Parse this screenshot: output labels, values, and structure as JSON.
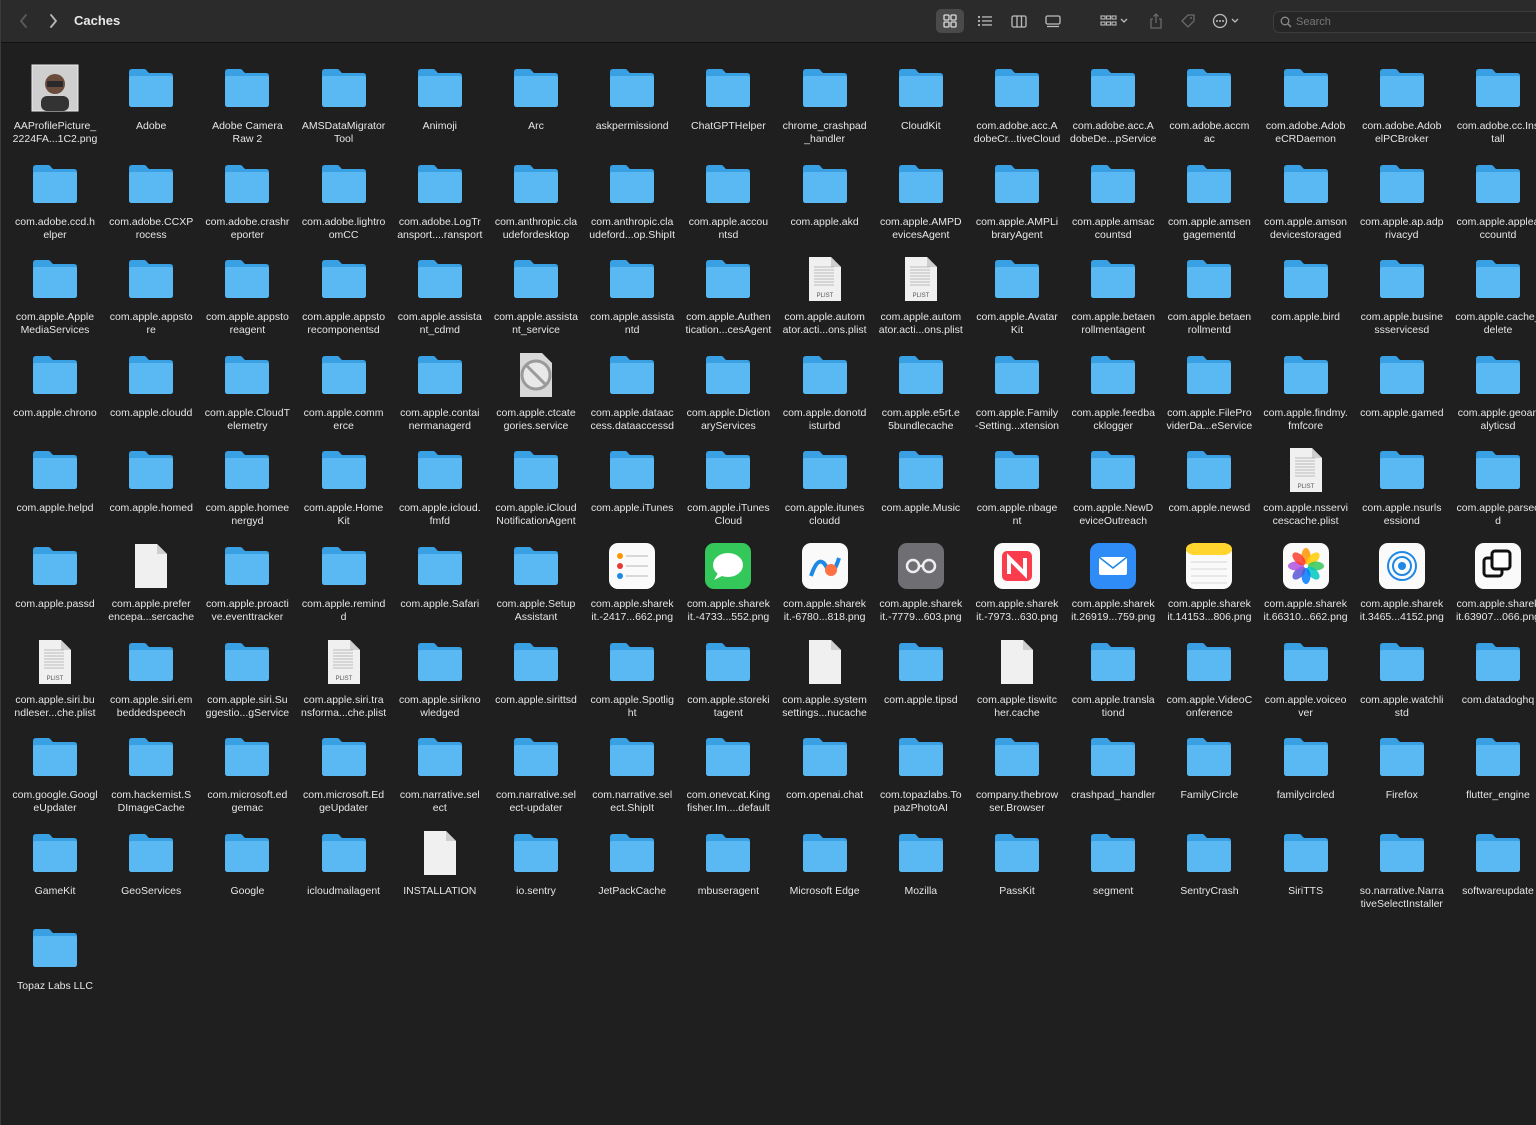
{
  "toolbar": {
    "title": "Caches",
    "search_placeholder": "Search"
  },
  "items": [
    {
      "label": "AAProfilePicture_\n2224FA...1C2.png",
      "kind": "avatar"
    },
    {
      "label": "Adobe",
      "kind": "folder"
    },
    {
      "label": "Adobe Camera\nRaw 2",
      "kind": "folder"
    },
    {
      "label": "AMSDataMigrator\nTool",
      "kind": "folder"
    },
    {
      "label": "Animoji",
      "kind": "folder"
    },
    {
      "label": "Arc",
      "kind": "folder"
    },
    {
      "label": "askpermissiond",
      "kind": "folder"
    },
    {
      "label": "ChatGPTHelper",
      "kind": "folder"
    },
    {
      "label": "chrome_crashpad\n_handler",
      "kind": "folder"
    },
    {
      "label": "CloudKit",
      "kind": "folder"
    },
    {
      "label": "com.adobe.acc.A\ndobeCr...tiveCloud",
      "kind": "folder"
    },
    {
      "label": "com.adobe.acc.A\ndobeDe...pService",
      "kind": "folder"
    },
    {
      "label": "com.adobe.accm\nac",
      "kind": "folder"
    },
    {
      "label": "com.adobe.Adob\neCRDaemon",
      "kind": "folder"
    },
    {
      "label": "com.adobe.Adob\nelPCBroker",
      "kind": "folder"
    },
    {
      "label": "com.adobe.cc.Ins\ntall",
      "kind": "folder"
    },
    {
      "label": "com.adobe.ccd.h\nelper",
      "kind": "folder"
    },
    {
      "label": "com.adobe.CCXP\nrocess",
      "kind": "folder"
    },
    {
      "label": "com.adobe.crashr\neporter",
      "kind": "folder"
    },
    {
      "label": "com.adobe.lightro\nomCC",
      "kind": "folder"
    },
    {
      "label": "com.adobe.LogTr\nansport....ransport",
      "kind": "folder"
    },
    {
      "label": "com.anthropic.cla\nudefordesktop",
      "kind": "folder"
    },
    {
      "label": "com.anthropic.cla\nudeford...op.ShipIt",
      "kind": "folder"
    },
    {
      "label": "com.apple.accou\nntsd",
      "kind": "folder"
    },
    {
      "label": "com.apple.akd",
      "kind": "folder"
    },
    {
      "label": "com.apple.AMPD\nevicesAgent",
      "kind": "folder"
    },
    {
      "label": "com.apple.AMPLi\nbraryAgent",
      "kind": "folder"
    },
    {
      "label": "com.apple.amsac\ncountsd",
      "kind": "folder"
    },
    {
      "label": "com.apple.amsen\ngagementd",
      "kind": "folder"
    },
    {
      "label": "com.apple.amson\ndevicestoraged",
      "kind": "folder"
    },
    {
      "label": "com.apple.ap.adp\nrivacyd",
      "kind": "folder"
    },
    {
      "label": "com.apple.applea\nccountd",
      "kind": "folder"
    },
    {
      "label": "com.apple.Apple\nMediaServices",
      "kind": "folder"
    },
    {
      "label": "com.apple.appsto\nre",
      "kind": "folder"
    },
    {
      "label": "com.apple.appsto\nreagent",
      "kind": "folder"
    },
    {
      "label": "com.apple.appsto\nrecomponentsd",
      "kind": "folder"
    },
    {
      "label": "com.apple.assista\nnt_cdmd",
      "kind": "folder"
    },
    {
      "label": "com.apple.assista\nnt_service",
      "kind": "folder"
    },
    {
      "label": "com.apple.assista\nntd",
      "kind": "folder"
    },
    {
      "label": "com.apple.Authen\ntication...cesAgent",
      "kind": "folder"
    },
    {
      "label": "com.apple.autom\nator.acti...ons.plist",
      "kind": "plist",
      "tag": "PLIST"
    },
    {
      "label": "com.apple.autom\nator.acti...ons.plist",
      "kind": "plist",
      "tag": "PLIST"
    },
    {
      "label": "com.apple.Avatar\nKit",
      "kind": "folder"
    },
    {
      "label": "com.apple.betaen\nrollmentagent",
      "kind": "folder"
    },
    {
      "label": "com.apple.betaen\nrollmentd",
      "kind": "folder"
    },
    {
      "label": "com.apple.bird",
      "kind": "folder"
    },
    {
      "label": "com.apple.busine\nssservicesd",
      "kind": "folder"
    },
    {
      "label": "com.apple.cache_\ndelete",
      "kind": "folder"
    },
    {
      "label": "com.apple.chrono",
      "kind": "folder"
    },
    {
      "label": "com.apple.cloudd",
      "kind": "folder"
    },
    {
      "label": "com.apple.CloudT\nelemetry",
      "kind": "folder"
    },
    {
      "label": "com.apple.comm\nerce",
      "kind": "folder"
    },
    {
      "label": "com.apple.contai\nnermanagerd",
      "kind": "folder"
    },
    {
      "label": "com.apple.ctcate\ngories.service",
      "kind": "blocked"
    },
    {
      "label": "com.apple.dataac\ncess.dataaccessd",
      "kind": "folder"
    },
    {
      "label": "com.apple.Diction\naryServices",
      "kind": "folder"
    },
    {
      "label": "com.apple.donotd\nisturbd",
      "kind": "folder"
    },
    {
      "label": "com.apple.e5rt.e\n5bundlecache",
      "kind": "folder"
    },
    {
      "label": "com.apple.Family\n-Setting...xtension",
      "kind": "folder"
    },
    {
      "label": "com.apple.feedba\ncklogger",
      "kind": "folder"
    },
    {
      "label": "com.apple.FilePro\nviderDa...eService",
      "kind": "folder"
    },
    {
      "label": "com.apple.findmy.\nfmfcore",
      "kind": "folder"
    },
    {
      "label": "com.apple.gamed",
      "kind": "folder"
    },
    {
      "label": "com.apple.geoan\nalyticsd",
      "kind": "folder"
    },
    {
      "label": "com.apple.helpd",
      "kind": "folder"
    },
    {
      "label": "com.apple.homed",
      "kind": "folder"
    },
    {
      "label": "com.apple.homee\nnergyd",
      "kind": "folder"
    },
    {
      "label": "com.apple.Home\nKit",
      "kind": "folder"
    },
    {
      "label": "com.apple.icloud.\nfmfd",
      "kind": "folder"
    },
    {
      "label": "com.apple.iCloud\nNotificationAgent",
      "kind": "folder"
    },
    {
      "label": "com.apple.iTunes",
      "kind": "folder"
    },
    {
      "label": "com.apple.iTunes\nCloud",
      "kind": "folder"
    },
    {
      "label": "com.apple.itunes\ncloudd",
      "kind": "folder"
    },
    {
      "label": "com.apple.Music",
      "kind": "folder"
    },
    {
      "label": "com.apple.nbage\nnt",
      "kind": "folder"
    },
    {
      "label": "com.apple.NewD\neviceOutreach",
      "kind": "folder"
    },
    {
      "label": "com.apple.newsd",
      "kind": "folder"
    },
    {
      "label": "com.apple.nsservi\ncescache.plist",
      "kind": "plist",
      "tag": "PLIST"
    },
    {
      "label": "com.apple.nsurls\nessiond",
      "kind": "folder"
    },
    {
      "label": "com.apple.parsec\nd",
      "kind": "folder"
    },
    {
      "label": "com.apple.passd",
      "kind": "folder"
    },
    {
      "label": "com.apple.prefer\nencepa...sercache",
      "kind": "doc"
    },
    {
      "label": "com.apple.proacti\nve.eventtracker",
      "kind": "folder"
    },
    {
      "label": "com.apple.remind\nd",
      "kind": "folder"
    },
    {
      "label": "com.apple.Safari",
      "kind": "folder"
    },
    {
      "label": "com.apple.Setup\nAssistant",
      "kind": "folder"
    },
    {
      "label": "com.apple.sharek\nit.-2417...662.png",
      "kind": "app",
      "app": "reminders"
    },
    {
      "label": "com.apple.sharek\nit.-4733...552.png",
      "kind": "app",
      "app": "messages"
    },
    {
      "label": "com.apple.sharek\nit.-6780...818.png",
      "kind": "app",
      "app": "freeform"
    },
    {
      "label": "com.apple.sharek\nit.-7779...603.png",
      "kind": "app",
      "app": "glasses"
    },
    {
      "label": "com.apple.sharek\nit.-7973...630.png",
      "kind": "app",
      "app": "news"
    },
    {
      "label": "com.apple.sharek\nit.26919...759.png",
      "kind": "app",
      "app": "mail"
    },
    {
      "label": "com.apple.sharek\nit.14153...806.png",
      "kind": "app",
      "app": "notes"
    },
    {
      "label": "com.apple.sharek\nit.66310...662.png",
      "kind": "app",
      "app": "photos"
    },
    {
      "label": "com.apple.sharek\nit.3465...4152.png",
      "kind": "app",
      "app": "airdrop"
    },
    {
      "label": "com.apple.sharek\nit.63907...066.png",
      "kind": "app",
      "app": "windows"
    },
    {
      "label": "com.apple.siri.bu\nndleser...che.plist",
      "kind": "plist",
      "tag": "PLIST"
    },
    {
      "label": "com.apple.siri.em\nbeddedspeech",
      "kind": "folder"
    },
    {
      "label": "com.apple.siri.Su\nggestio...gService",
      "kind": "folder"
    },
    {
      "label": "com.apple.siri.tra\nnsforma...che.plist",
      "kind": "plist",
      "tag": "PLIST"
    },
    {
      "label": "com.apple.sirikno\nwledged",
      "kind": "folder"
    },
    {
      "label": "com.apple.sirittsd",
      "kind": "folder"
    },
    {
      "label": "com.apple.Spotlig\nht",
      "kind": "folder"
    },
    {
      "label": "com.apple.storeki\ntagent",
      "kind": "folder"
    },
    {
      "label": "com.apple.system\nsettings...nucache",
      "kind": "doc"
    },
    {
      "label": "com.apple.tipsd",
      "kind": "folder"
    },
    {
      "label": "com.apple.tiswitc\nher.cache",
      "kind": "doc"
    },
    {
      "label": "com.apple.transla\ntiond",
      "kind": "folder"
    },
    {
      "label": "com.apple.VideoC\nonference",
      "kind": "folder"
    },
    {
      "label": "com.apple.voiceo\nver",
      "kind": "folder"
    },
    {
      "label": "com.apple.watchli\nstd",
      "kind": "folder"
    },
    {
      "label": "com.datadoghq",
      "kind": "folder"
    },
    {
      "label": "com.google.Googl\neUpdater",
      "kind": "folder"
    },
    {
      "label": "com.hackemist.S\nDImageCache",
      "kind": "folder"
    },
    {
      "label": "com.microsoft.ed\ngemac",
      "kind": "folder"
    },
    {
      "label": "com.microsoft.Ed\ngeUpdater",
      "kind": "folder"
    },
    {
      "label": "com.narrative.sel\nect",
      "kind": "folder"
    },
    {
      "label": "com.narrative.sel\nect-updater",
      "kind": "folder"
    },
    {
      "label": "com.narrative.sel\nect.ShipIt",
      "kind": "folder"
    },
    {
      "label": "com.onevcat.King\nfisher.Im....default",
      "kind": "folder"
    },
    {
      "label": "com.openai.chat",
      "kind": "folder"
    },
    {
      "label": "com.topazlabs.To\npazPhotoAI",
      "kind": "folder"
    },
    {
      "label": "company.thebrow\nser.Browser",
      "kind": "folder"
    },
    {
      "label": "crashpad_handler",
      "kind": "folder"
    },
    {
      "label": "FamilyCircle",
      "kind": "folder"
    },
    {
      "label": "familycircled",
      "kind": "folder"
    },
    {
      "label": "Firefox",
      "kind": "folder"
    },
    {
      "label": "flutter_engine",
      "kind": "folder"
    },
    {
      "label": "GameKit",
      "kind": "folder"
    },
    {
      "label": "GeoServices",
      "kind": "folder"
    },
    {
      "label": "Google",
      "kind": "folder"
    },
    {
      "label": "icloudmailagent",
      "kind": "folder"
    },
    {
      "label": "INSTALLATION",
      "kind": "doc"
    },
    {
      "label": "io.sentry",
      "kind": "folder"
    },
    {
      "label": "JetPackCache",
      "kind": "folder"
    },
    {
      "label": "mbuseragent",
      "kind": "folder"
    },
    {
      "label": "Microsoft Edge",
      "kind": "folder"
    },
    {
      "label": "Mozilla",
      "kind": "folder"
    },
    {
      "label": "PassKit",
      "kind": "folder"
    },
    {
      "label": "segment",
      "kind": "folder"
    },
    {
      "label": "SentryCrash",
      "kind": "folder"
    },
    {
      "label": "SiriTTS",
      "kind": "folder"
    },
    {
      "label": "so.narrative.Narra\ntiveSelectInstaller",
      "kind": "folder"
    },
    {
      "label": "softwareupdate",
      "kind": "folder"
    },
    {
      "label": "Topaz Labs LLC",
      "kind": "folder"
    }
  ]
}
